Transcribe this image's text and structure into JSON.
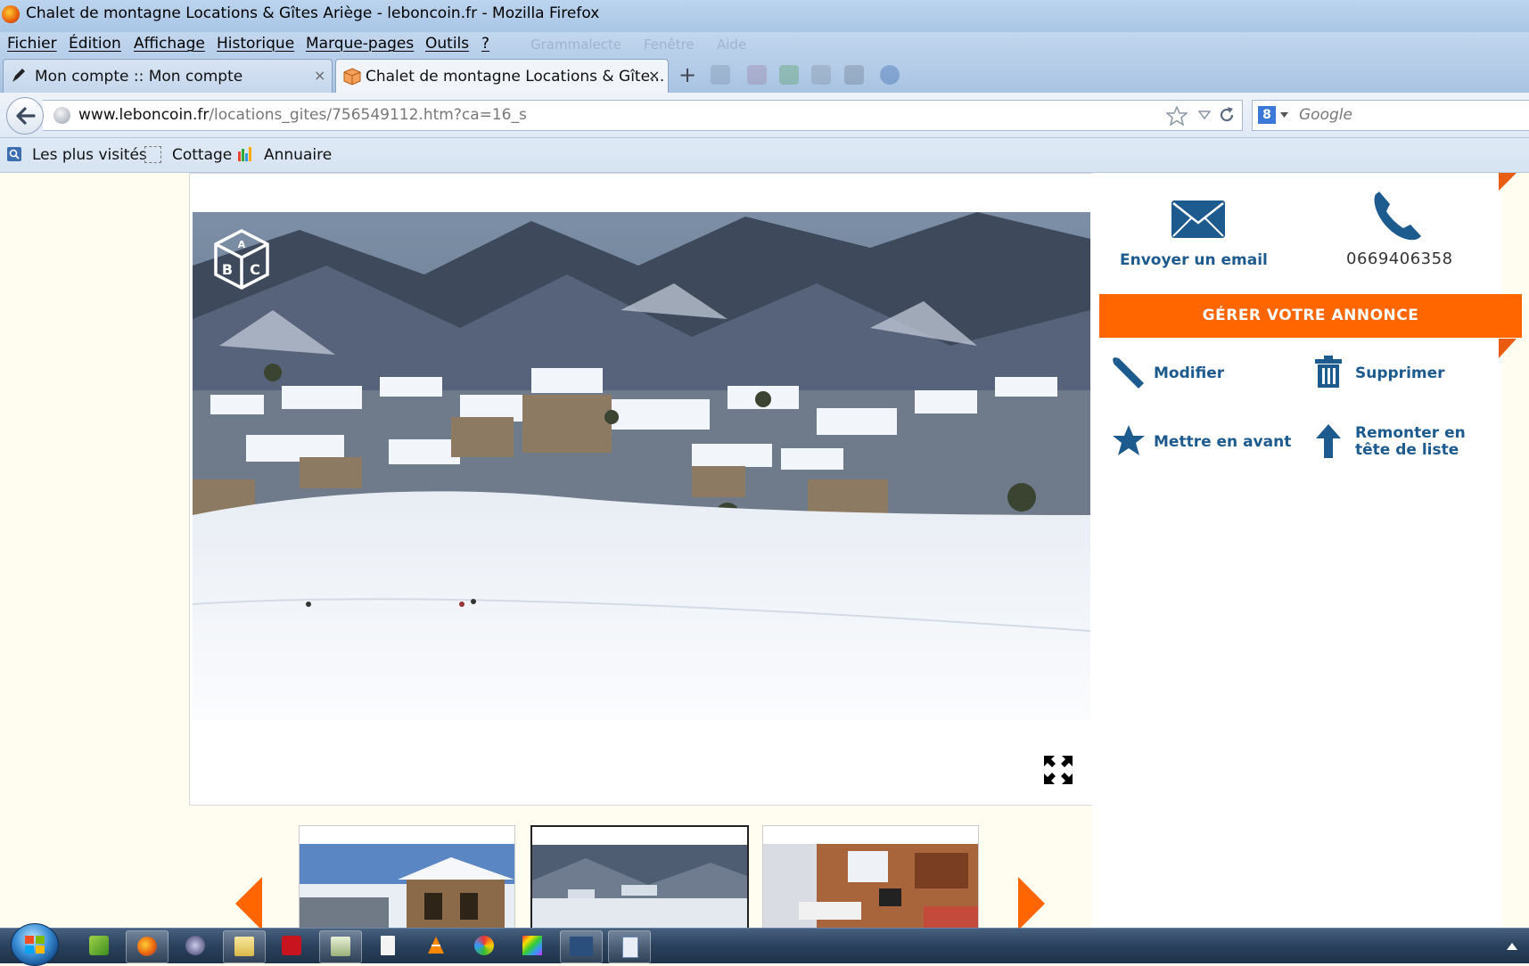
{
  "window": {
    "title": "Chalet de montagne Locations & Gîtes Ariège - leboncoin.fr - Mozilla Firefox"
  },
  "menubar": {
    "items": [
      "Fichier",
      "Édition",
      "Affichage",
      "Historique",
      "Marque-pages",
      "Outils",
      "?"
    ],
    "ghost_items": [
      "Grammalecte",
      "Fenêtre",
      "Aide"
    ]
  },
  "tabs": [
    {
      "label": "Mon compte :: Mon compte",
      "close": "×"
    },
    {
      "label": "Chalet de montagne Locations & Gîte...",
      "close": "×"
    }
  ],
  "newtab": {
    "label": "+"
  },
  "navbar": {
    "url_domain": "www.leboncoin.fr",
    "url_path": "/locations_gites/756549112.htm?ca=16_s",
    "search_engine_badge": "8",
    "search_placeholder": "Google"
  },
  "bookmarks": {
    "items": [
      "Les plus visités",
      "Cottage",
      "Annuaire"
    ]
  },
  "listing": {
    "logo_letters": [
      "A",
      "B",
      "C"
    ]
  },
  "contact": {
    "email_label": "Envoyer un email",
    "phone_number": "0669406358"
  },
  "manage": {
    "button_label": "GÉRER VOTRE ANNONCE",
    "actions": {
      "edit": "Modifier",
      "delete": "Supprimer",
      "feature": "Mettre en avant",
      "bump_line1": "Remonter en",
      "bump_line2": "tête de liste"
    }
  },
  "colors": {
    "accent": "#ff6600",
    "link_blue": "#1d5a8e",
    "page_bg": "#fffdf0"
  }
}
